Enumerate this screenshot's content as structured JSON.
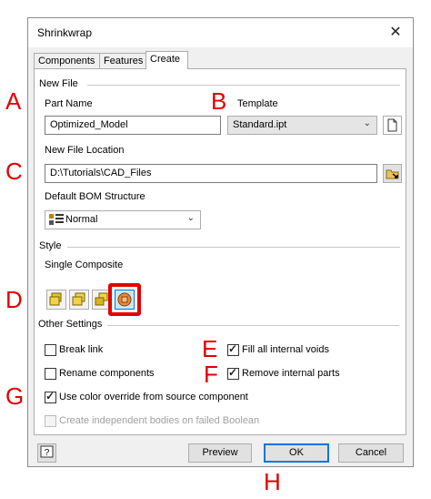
{
  "window": {
    "title": "Shrinkwrap",
    "close_glyph": "✕"
  },
  "tabs": [
    {
      "label": "Components"
    },
    {
      "label": "Features"
    },
    {
      "label": "Create",
      "active": true
    }
  ],
  "new_file": {
    "section_label": "New File",
    "part_name_label": "Part Name",
    "part_name_value": "Optimized_Model",
    "template_label": "Template",
    "template_value": "Standard.ipt",
    "location_label": "New File Location",
    "location_value": "D:\\Tutorials\\CAD_Files",
    "bom_label": "Default BOM Structure",
    "bom_value": "Normal"
  },
  "style": {
    "section_label": "Style",
    "mode_label": "Single Composite",
    "options": [
      {
        "icon": "single-body-merge-icon"
      },
      {
        "icon": "single-body-no-seams-icon"
      },
      {
        "icon": "multiple-solid-bodies-icon"
      },
      {
        "icon": "single-composite-icon",
        "selected": true
      }
    ]
  },
  "other_settings": {
    "section_label": "Other Settings",
    "break_link": {
      "label": "Break link",
      "checked": false
    },
    "fill_voids": {
      "label": "Fill all internal voids",
      "checked": true
    },
    "rename_components": {
      "label": "Rename components",
      "checked": false
    },
    "remove_internal": {
      "label": "Remove internal parts",
      "checked": true
    },
    "color_override": {
      "label": "Use color override from source component",
      "checked": true
    },
    "independent_bodies": {
      "label": "Create independent bodies on failed Boolean",
      "checked": false,
      "disabled": true
    }
  },
  "footer": {
    "help_icon": "help-icon",
    "preview_label": "Preview",
    "ok_label": "OK",
    "cancel_label": "Cancel"
  },
  "annotations": {
    "A": "A",
    "B": "B",
    "C": "C",
    "D": "D",
    "E": "E",
    "F": "F",
    "G": "G",
    "H": "H",
    "color": "#e30000"
  }
}
